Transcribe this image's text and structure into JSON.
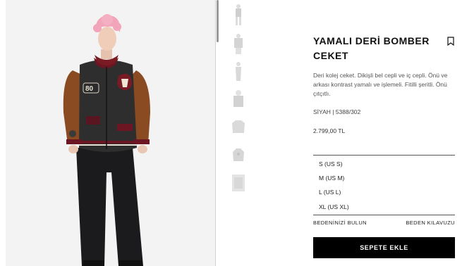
{
  "product": {
    "title": "YAMALI DERİ BOMBER CEKET",
    "description": "Deri kolej ceket. Dikişli bel cepli ve iç cepli. Önü ve arkası kontrast yamalı ve işlemeli. Fitilli şeritli. Önü çıtçıtlı.",
    "sku": "SİYAH | 5388/302",
    "price": "2.799,00 TL"
  },
  "sizes": [
    "S (US S)",
    "M (US M)",
    "L (US L)",
    "XL (US XL)"
  ],
  "links": {
    "find_size": "BEDENİNİZİ BULUN",
    "size_guide": "BEDEN KILAVUZU"
  },
  "actions": {
    "add_to_cart": "SEPETE EKLE"
  },
  "patch_texts": {
    "number": "80"
  },
  "colors": {
    "primary": "#000000",
    "background": "#ffffff",
    "leather": "#2e2e2e",
    "sleeve": "#8a4a22"
  },
  "icons": {
    "bookmark": "bookmark-icon"
  }
}
